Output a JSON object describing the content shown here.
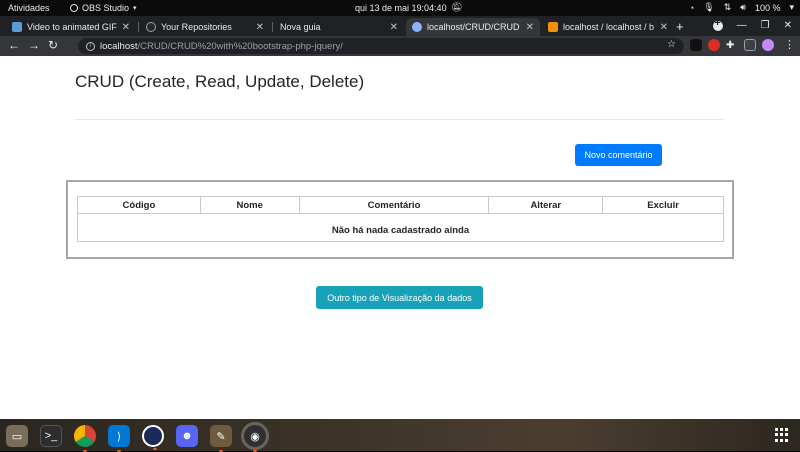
{
  "topbar": {
    "activities": "Atividades",
    "app_name": "OBS Studio",
    "clock": "qui 13 de mai  19:04:40",
    "battery": "100 %"
  },
  "tabs": [
    {
      "title": "Video to animated GIF c",
      "favicon_color": "#5b9bd5"
    },
    {
      "title": "Your Repositories",
      "favicon_color": "#24292e"
    },
    {
      "title": "Nova guia",
      "favicon_color": "#35363a"
    },
    {
      "title": "localhost/CRUD/CRUD",
      "favicon_color": "#8ab4f8",
      "active": true
    },
    {
      "title": "localhost / localhost / b",
      "favicon_color": "#f29111"
    }
  ],
  "omnibox": {
    "host": "localhost",
    "path": "/CRUD/CRUD%20with%20bootstrap-php-jquery/"
  },
  "page": {
    "title": "CRUD (Create, Read, Update, Delete)",
    "new_comment_button": "Novo comentário",
    "table": {
      "headers": [
        "Código",
        "Nome",
        "Comentário",
        "Alterar",
        "Excluir"
      ],
      "empty_message": "Não há nada cadastrado ainda"
    },
    "other_view_button": "Outro tipo de Visualização da dados"
  },
  "dock": [
    {
      "name": "files",
      "color": "#7a6d5c"
    },
    {
      "name": "terminal",
      "color": "#2d2d2d"
    },
    {
      "name": "chrome",
      "color": "#db4437"
    },
    {
      "name": "vscode",
      "color": "#0078d4"
    },
    {
      "name": "app-blue-globe",
      "color": "#1b2a5a"
    },
    {
      "name": "discord",
      "color": "#5865f2"
    },
    {
      "name": "gimp",
      "color": "#6e5a3e"
    },
    {
      "name": "obs",
      "color": "#302e31"
    }
  ]
}
